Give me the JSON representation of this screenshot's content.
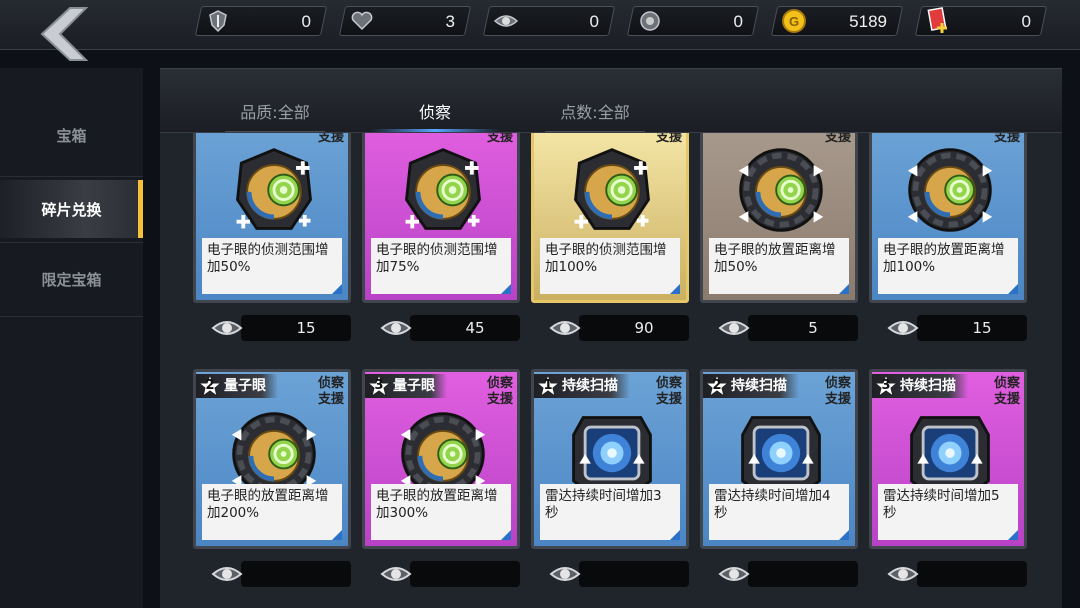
{
  "resources": [
    {
      "icon": "shield-icon",
      "value": "0"
    },
    {
      "icon": "heart-icon",
      "value": "3"
    },
    {
      "icon": "eye-icon",
      "value": "0"
    },
    {
      "icon": "medal-icon",
      "value": "0"
    },
    {
      "icon": "gold-coin-icon",
      "value": "5189"
    },
    {
      "icon": "card-ticket-icon",
      "value": "0"
    }
  ],
  "sidenav": [
    {
      "label": "宝箱"
    },
    {
      "label": "碎片兑换"
    },
    {
      "label": "限定宝箱"
    }
  ],
  "tabs": [
    {
      "label": "品质:全部"
    },
    {
      "label": "侦察"
    },
    {
      "label": "点数:全部"
    }
  ],
  "cards": [
    {
      "tag": "支援",
      "desc": "电子眼的侦测范围增加50%",
      "cost": "15",
      "rarity": "blue",
      "art": "eye-plus"
    },
    {
      "tag": "支援",
      "desc": "电子眼的侦测范围增加75%",
      "cost": "45",
      "rarity": "purple",
      "art": "eye-plus"
    },
    {
      "tag": "支援",
      "desc": "电子眼的侦测范围增加100%",
      "cost": "90",
      "rarity": "gold",
      "art": "eye-plus"
    },
    {
      "tag": "支援",
      "desc": "电子眼的放置距离增加50%",
      "cost": "5",
      "rarity": "brown",
      "art": "eye-arrows"
    },
    {
      "tag": "支援",
      "desc": "电子眼的放置距离增加100%",
      "cost": "15",
      "rarity": "blue",
      "art": "eye-arrows"
    },
    {
      "rank": "2",
      "name": "量子眼",
      "tag1": "侦察",
      "tag2": "支援",
      "desc": "电子眼的放置距离增加200%",
      "rarity": "blue",
      "art": "eye-arrows"
    },
    {
      "rank": "3",
      "name": "量子眼",
      "tag1": "侦察",
      "tag2": "支援",
      "desc": "电子眼的放置距离增加300%",
      "rarity": "purple",
      "art": "eye-arrows"
    },
    {
      "rank": "1",
      "name": "持续扫描",
      "tag1": "侦察",
      "tag2": "支援",
      "desc": "雷达持续时间增加3秒",
      "rarity": "blue",
      "art": "radar"
    },
    {
      "rank": "2",
      "name": "持续扫描",
      "tag1": "侦察",
      "tag2": "支援",
      "desc": "雷达持续时间增加4秒",
      "rarity": "blue",
      "art": "radar"
    },
    {
      "rank": "3",
      "name": "持续扫描",
      "tag1": "侦察",
      "tag2": "支援",
      "desc": "雷达持续时间增加5秒",
      "rarity": "purple",
      "art": "radar"
    }
  ],
  "colors": {
    "active_nav_accent": "#f5c13a",
    "active_tab_underline": "#59a6ff",
    "rarity_blue": "#5a94cf",
    "rarity_purple": "#cc4fd5",
    "rarity_gold": "#e8d68e",
    "rarity_brown": "#9a8b7e"
  }
}
